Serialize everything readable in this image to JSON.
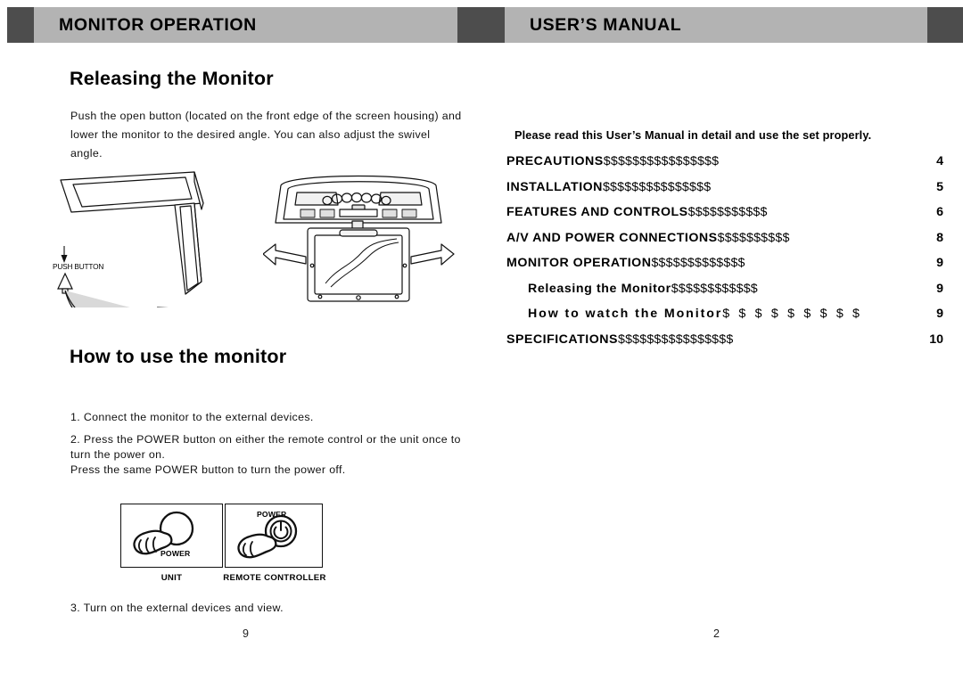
{
  "headers": {
    "left_title": "MONITOR OPERATION",
    "right_title": "USER’S MANUAL"
  },
  "left_page": {
    "releasing_heading": "Releasing the Monitor",
    "releasing_paragraph": "Push the open button (located on the front edge of the screen housing) and lower the monitor to the desired angle. You can also adjust the swivel angle.",
    "push_button_label": "PUSH BUTTON",
    "howto_heading": "How to use the monitor",
    "step_1": "1. Connect the monitor to the external devices.",
    "step_2": "2. Press the POWER button on either the remote control or the unit once to turn the power on.\nPress the same POWER button to turn the power off.",
    "step_3": "3. Turn on the external devices and view.",
    "power_diagram": {
      "unit_power_label": "POWER",
      "unit_caption": "UNIT",
      "remote_power_label": "POWER",
      "remote_caption": "REMOTE CONTROLLER"
    },
    "page_number": "9"
  },
  "right_page": {
    "please_read": "Please read this User’s Manual in detail and use the set properly.",
    "toc": [
      {
        "label": "PRECAUTIONS",
        "leader": "$$$$$$$$$$$$$$$$",
        "page": "4"
      },
      {
        "label": "INSTALLATION",
        "leader": "$$$$$$$$$$$$$$$",
        "page": "5"
      },
      {
        "label": "FEATURES AND CONTROLS",
        "leader": "$$$$$$$$$$$",
        "page": "6"
      },
      {
        "label": "A/V AND POWER CONNECTIONS",
        "leader": "$$$$$$$$$$",
        "page": "8"
      },
      {
        "label": "MONITOR OPERATION",
        "leader": "$$$$$$$$$$$$$",
        "page": "9"
      },
      {
        "label": "Releasing the Monitor",
        "leader": "$$$$$$$$$$$$",
        "page": "9"
      },
      {
        "label": "How to watch the Monitor",
        "leader": "$ $ $ $ $ $ $ $ $",
        "page": "9"
      },
      {
        "label": "SPECIFICATIONS",
        "leader": "$$$$$$$$$$$$$$$$",
        "page": "10"
      }
    ],
    "page_number": "2"
  },
  "colors": {
    "header_bar": "#b3b3b3",
    "header_cap": "#4d4d4d",
    "text": "#000000",
    "illustration_fill": "#e8e8e8"
  }
}
